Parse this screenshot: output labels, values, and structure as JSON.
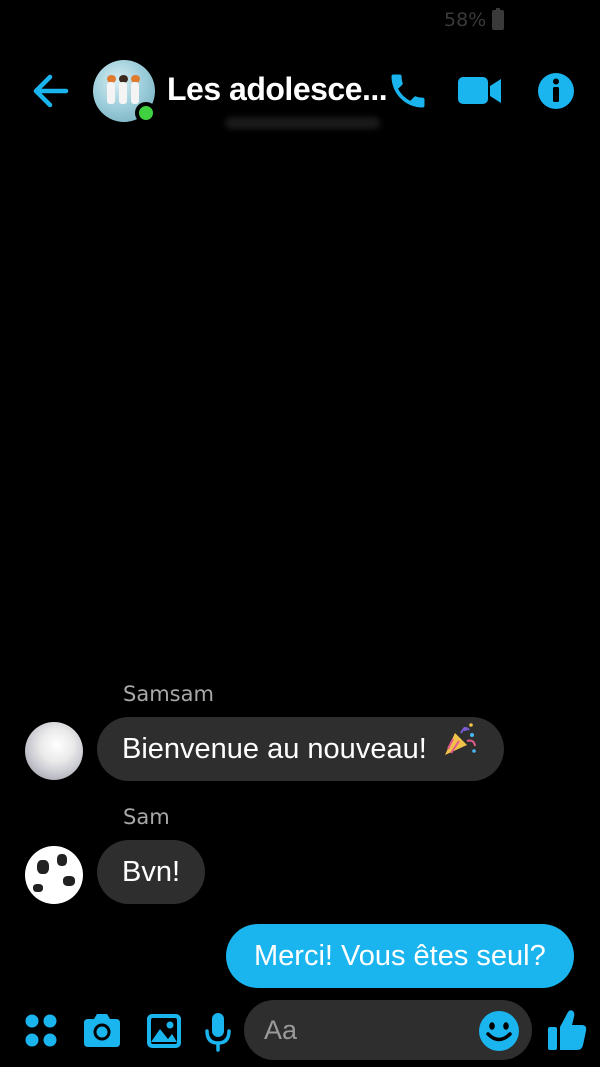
{
  "status_bar": {
    "battery": "58%"
  },
  "header": {
    "title": "Les adolesce..."
  },
  "messages": [
    {
      "sender": "Samsam",
      "text": "Bienvenue au nouveau!",
      "emoji": "party-popper"
    },
    {
      "sender": "Sam",
      "text": "Bvn!"
    },
    {
      "text": "Merci! Vous êtes seul?"
    }
  ],
  "composer": {
    "placeholder": "Aa"
  },
  "colors": {
    "accent": "#1ab5ee",
    "incoming_bubble": "#2e2e2e",
    "online": "#3fd13f",
    "background": "#000000"
  },
  "icons": [
    "back-arrow-icon",
    "phone-icon",
    "video-camera-icon",
    "info-icon",
    "apps-grid-icon",
    "camera-icon",
    "image-icon",
    "microphone-icon",
    "smiley-icon",
    "thumbs-up-icon"
  ]
}
